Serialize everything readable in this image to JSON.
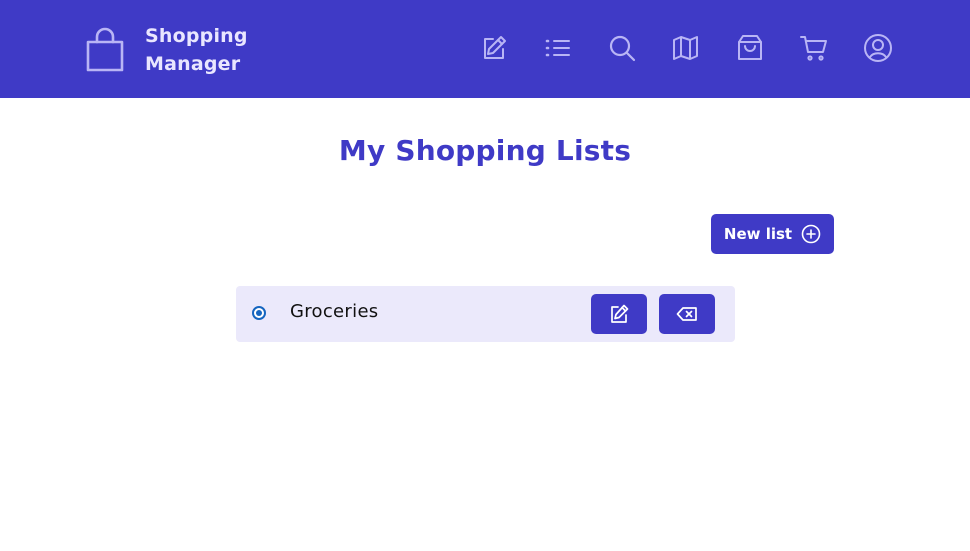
{
  "header": {
    "brand_line1": "Shopping",
    "brand_line2": "Manager",
    "nav": [
      {
        "icon": "edit-icon"
      },
      {
        "icon": "list-icon"
      },
      {
        "icon": "search-icon"
      },
      {
        "icon": "map-icon"
      },
      {
        "icon": "shopping-bag-icon"
      },
      {
        "icon": "cart-icon"
      },
      {
        "icon": "user-circle-icon"
      }
    ]
  },
  "main": {
    "title": "My Shopping Lists",
    "new_list_label": "New list",
    "lists": [
      {
        "name": "Groceries",
        "selected": true
      }
    ]
  },
  "colors": {
    "primary": "#3f3ac6",
    "row_background": "#ebe9fb",
    "radio": "#1565c0",
    "header_text": "#e9e6ff"
  }
}
